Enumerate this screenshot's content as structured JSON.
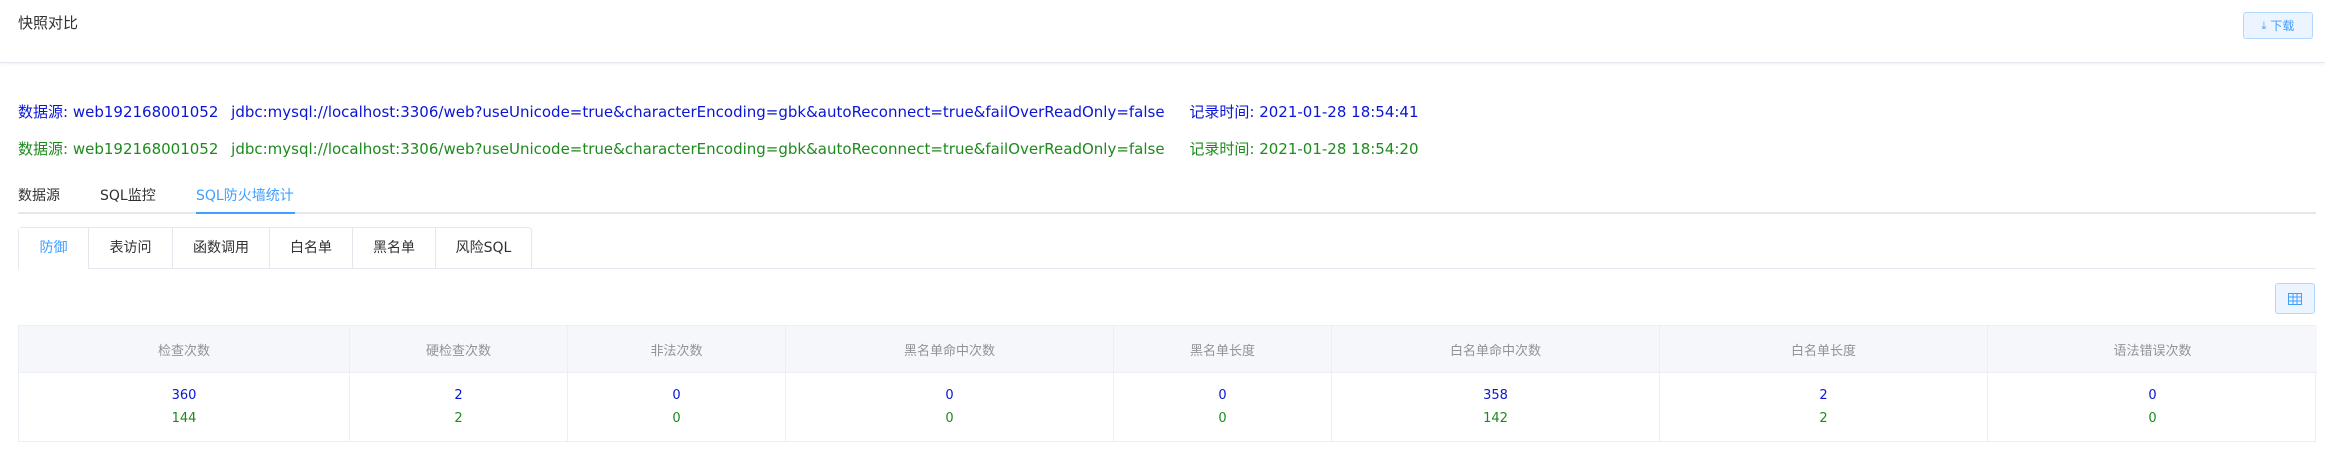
{
  "header": {
    "title": "快照对比",
    "download_label": "下载",
    "download_icon": "download-icon"
  },
  "sources": [
    {
      "label": "数据源:",
      "name": "web192168001052",
      "url": "jdbc:mysql://localhost:3306/web?useUnicode=true&characterEncoding=gbk&autoReconnect=true&failOverReadOnly=false",
      "time_label": "记录时间:",
      "time": "2021-01-28 18:54:41",
      "color": "#0b15d6"
    },
    {
      "label": "数据源:",
      "name": "web192168001052",
      "url": "jdbc:mysql://localhost:3306/web?useUnicode=true&characterEncoding=gbk&autoReconnect=true&failOverReadOnly=false",
      "time_label": "记录时间:",
      "time": "2021-01-28 18:54:20",
      "color": "#1e8a1e"
    }
  ],
  "main_tabs": {
    "items": [
      "数据源",
      "SQL监控",
      "SQL防火墙统计"
    ],
    "active_index": 2
  },
  "sub_tabs": {
    "items": [
      "防御",
      "表访问",
      "函数调用",
      "白名单",
      "黑名单",
      "风险SQL"
    ],
    "active_index": 0
  },
  "toolbar": {
    "grid_icon": "table-grid-icon"
  },
  "table": {
    "headers": [
      "检查次数",
      "硬检查次数",
      "非法次数",
      "黑名单命中次数",
      "黑名单长度",
      "白名单命中次数",
      "白名单长度",
      "语法错误次数"
    ],
    "rows": [
      [
        "360",
        "2",
        "0",
        "0",
        "0",
        "358",
        "2",
        "0"
      ],
      [
        "144",
        "2",
        "0",
        "0",
        "0",
        "142",
        "2",
        "0"
      ]
    ]
  },
  "colors": {
    "accent": "#409eff",
    "snapshot_a": "#0b15d6",
    "snapshot_b": "#1e8a1e"
  }
}
